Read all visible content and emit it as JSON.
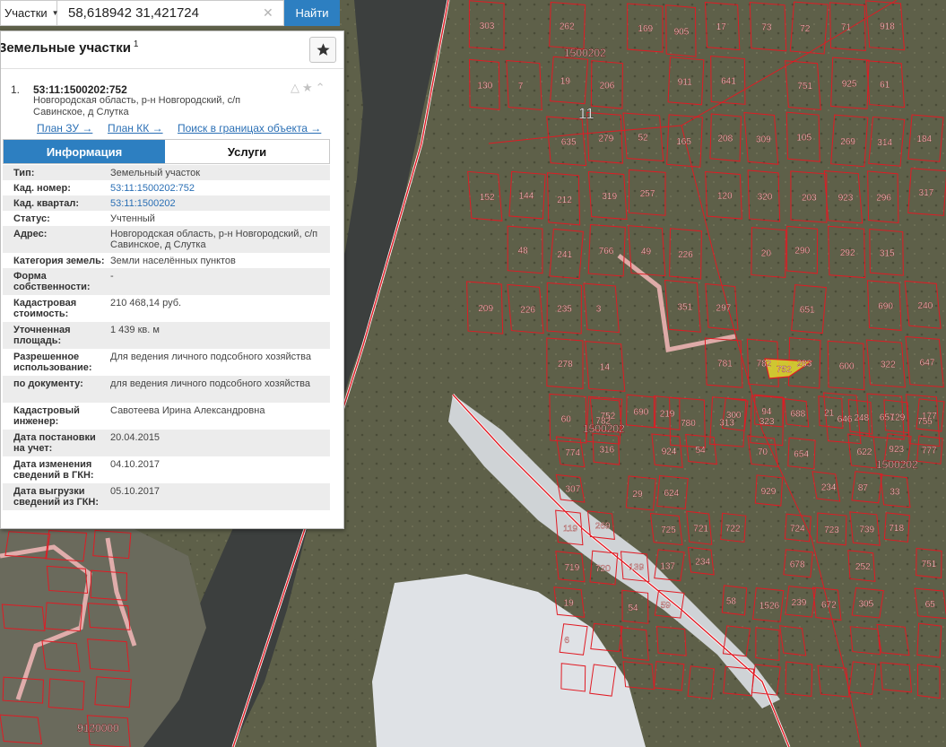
{
  "search": {
    "type_label": "Участки",
    "query": "58,618942 31,421724",
    "find_label": "Найти"
  },
  "panel": {
    "title": "Земельные участки",
    "count": "1",
    "result_index": "1.",
    "parcel_id": "53:11:1500202:752",
    "parcel_address": "Новгородская область, р-н Новгородский, с/п Савинское, д Слутка",
    "links": {
      "plan_zu": "План ЗУ →",
      "plan_kk": "План КК →",
      "search_bounds": "Поиск в границах объекта →"
    },
    "tabs": {
      "info": "Информация",
      "services": "Услуги"
    },
    "rows": [
      {
        "label": "Тип:",
        "value": "Земельный участок"
      },
      {
        "label": "Кад. номер:",
        "value": "53:11:1500202:752"
      },
      {
        "label": "Кад. квартал:",
        "value": "53:11:1500202"
      },
      {
        "label": "Статус:",
        "value": "Учтенный"
      },
      {
        "label": "Адрес:",
        "value": "Новгородская область, р-н Новгородский, с/п Савинское, д Слутка"
      },
      {
        "label": "Категория земель:",
        "value": "Земли населённых пунктов"
      },
      {
        "label": "Форма собственности:",
        "value": "-"
      },
      {
        "label": "Кадастровая стоимость:",
        "value": "210 468,14 руб."
      },
      {
        "label": "Уточненная площадь:",
        "value": "1 439 кв. м"
      },
      {
        "label": "Разрешенное использование:",
        "value": "Для ведения личного подсобного хозяйства"
      },
      {
        "label": "по документу:",
        "value": "для ведения личного подсобного хозяйства"
      },
      {
        "label": "Кадастровый инженер:",
        "value": "Савотеева Ирина Александровна"
      },
      {
        "label": "Дата постановки на учет:",
        "value": "20.04.2015"
      },
      {
        "label": "Дата изменения сведений в ГКН:",
        "value": "04.10.2017"
      },
      {
        "label": "Дата выгрузки сведений из ГКН:",
        "value": "05.10.2017"
      }
    ]
  },
  "map": {
    "quarter_labels": [
      "1500202",
      "1500202",
      "1500202",
      "9120000"
    ],
    "block_label": "11",
    "selected_parcel": "752",
    "parcel_labels": [
      "303",
      "262",
      "169",
      "905",
      "17",
      "73",
      "72",
      "71",
      "918",
      "130",
      "7",
      "19",
      "206",
      "911",
      "641",
      "751",
      "925",
      "61",
      "635",
      "279",
      "52",
      "165",
      "208",
      "309",
      "105",
      "269",
      "314",
      "184",
      "152",
      "144",
      "212",
      "319",
      "257",
      "120",
      "320",
      "203",
      "923",
      "296",
      "317",
      "48",
      "241",
      "766",
      "49",
      "226",
      "20",
      "290",
      "292",
      "315",
      "209",
      "226",
      "235",
      "3",
      "351",
      "297",
      "651",
      "690",
      "240",
      "278",
      "14",
      "781",
      "782",
      "283",
      "600",
      "322",
      "647",
      "60",
      "782",
      "780",
      "313",
      "323",
      "646",
      "657",
      "755",
      "752",
      "690",
      "219",
      "300",
      "94",
      "688",
      "21",
      "248",
      "129",
      "177",
      "774",
      "316",
      "924",
      "54",
      "70",
      "654",
      "622",
      "923",
      "777",
      "307",
      "29",
      "624",
      "929",
      "234",
      "87",
      "33",
      "119",
      "269",
      "725",
      "721",
      "722",
      "724",
      "723",
      "739",
      "718",
      "719",
      "720",
      "139",
      "137",
      "234",
      "678",
      "252",
      "751",
      "19",
      "54",
      "59",
      "58",
      "1526",
      "239",
      "672",
      "305",
      "65",
      "6"
    ],
    "colors": {
      "parcel_line": "#e01b24",
      "selected_fill": "#f5e829",
      "panel_accent": "#2d7fc1",
      "link": "#2a6fb5"
    }
  }
}
